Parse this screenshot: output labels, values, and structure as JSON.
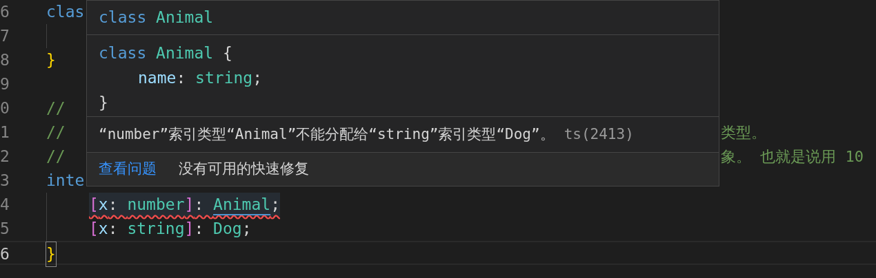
{
  "editor": {
    "lines": [
      {
        "number": "6",
        "tokens": [
          {
            "kind": "keyword",
            "text": "clas"
          }
        ],
        "children": [
          {
            "number": "7"
          }
        ]
      },
      {
        "number": "8",
        "tokens": [
          {
            "kind": "brace",
            "text": "}"
          }
        ]
      },
      {
        "number": "9"
      },
      {
        "number": "0",
        "tokens": [
          {
            "kind": "comment",
            "text": "//"
          }
        ]
      },
      {
        "number": "1",
        "tokens": [
          {
            "kind": "comment",
            "text": "//"
          }
        ],
        "right": "类型。"
      },
      {
        "number": "2",
        "tokens": [
          {
            "kind": "comment",
            "text": "//"
          }
        ],
        "right": "象。 也就是说用 10"
      },
      {
        "number": "3",
        "tokens": [
          {
            "kind": "keyword",
            "text": "inte"
          }
        ],
        "children": [
          {
            "number": "4",
            "error": true,
            "hovered": true,
            "tokens": [
              {
                "kind": "bracket",
                "text": "["
              },
              {
                "kind": "property",
                "text": "x"
              },
              {
                "kind": "plain",
                "text": ": "
              },
              {
                "kind": "type",
                "text": "number"
              },
              {
                "kind": "bracket",
                "text": "]"
              },
              {
                "kind": "plain",
                "text": ": "
              },
              {
                "kind": "type",
                "text": "Animal",
                "underlined": true
              },
              {
                "kind": "plain",
                "text": ";"
              }
            ]
          },
          {
            "number": "5",
            "tokens": [
              {
                "kind": "bracket",
                "text": "["
              },
              {
                "kind": "property",
                "text": "x"
              },
              {
                "kind": "plain",
                "text": ": "
              },
              {
                "kind": "type",
                "text": "string"
              },
              {
                "kind": "bracket",
                "text": "]"
              },
              {
                "kind": "plain",
                "text": ": "
              },
              {
                "kind": "type",
                "text": "Dog"
              },
              {
                "kind": "plain",
                "text": ";"
              }
            ]
          }
        ]
      },
      {
        "number": "6",
        "current": true,
        "tokens": [
          {
            "kind": "brace",
            "text": "}",
            "matched": true
          }
        ]
      }
    ]
  },
  "hover": {
    "title": [
      {
        "kind": "keyword",
        "text": "class"
      },
      {
        "kind": "type",
        "text": "Animal"
      }
    ],
    "code": [
      {
        "tokens": [
          {
            "kind": "keyword",
            "text": "class"
          },
          {
            "kind": "type",
            "text": "Animal"
          },
          {
            "kind": "open_brace",
            "text": "{"
          }
        ],
        "children": [
          {
            "tokens": [
              {
                "kind": "property",
                "text": "name"
              },
              {
                "kind": "plain",
                "text": ": "
              },
              {
                "kind": "type",
                "text": "string"
              },
              {
                "kind": "plain",
                "text": ";"
              }
            ]
          }
        ]
      },
      {
        "tokens": [
          {
            "kind": "plain",
            "text": "}"
          }
        ]
      }
    ],
    "message": "“number”索引类型“Animal”不能分配给“string”索引类型“Dog”。",
    "code_ref": "ts(2413)",
    "actions": [
      {
        "kind": "link",
        "text": "查看问题"
      },
      {
        "kind": "note",
        "text": "没有可用的快速修复"
      }
    ]
  }
}
